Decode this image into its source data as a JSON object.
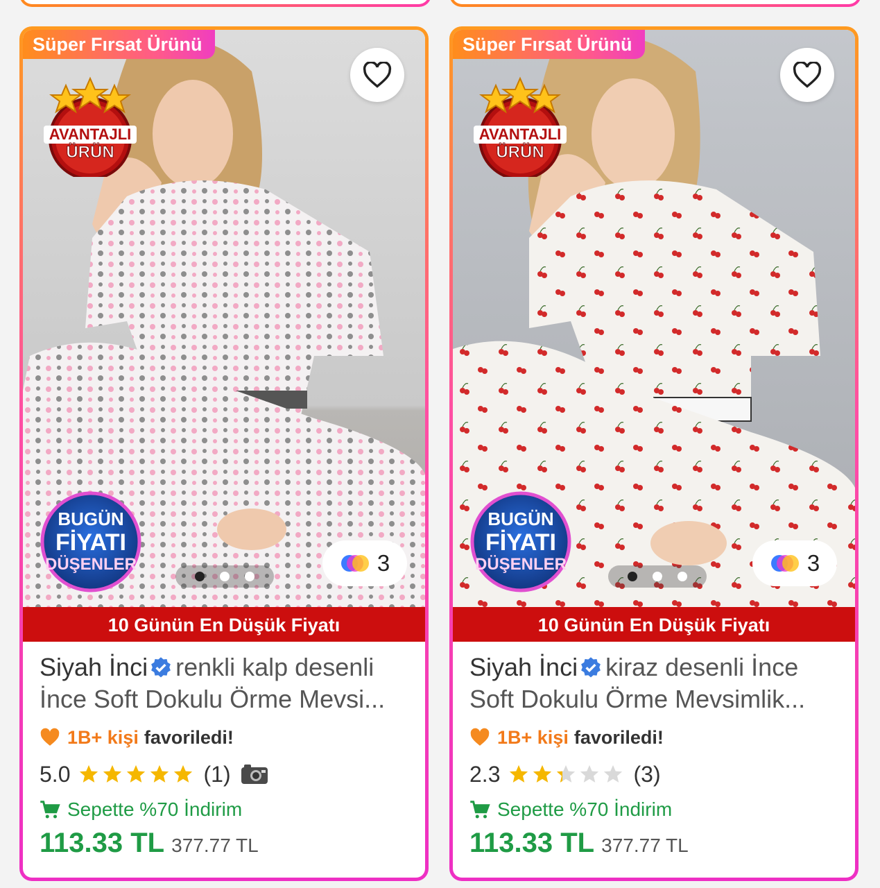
{
  "products": [
    {
      "super_badge": "Süper Fırsat Ürünü",
      "advantage_badge": [
        "AVANTAJLI",
        "ÜRÜN"
      ],
      "price_drop_badge": [
        "BUGÜN",
        "FİYATI",
        "DÜŞENLER"
      ],
      "variant_count": "3",
      "lowest_price_bar": "10 Günün En Düşük Fiyatı",
      "brand": "Siyah İnci",
      "title_line1": "renkli kalp desenli",
      "title_line2": "İnce Soft Dokulu Örme Mevsi...",
      "fav_count": "1B+ kişi",
      "fav_text": "favoriledi!",
      "rating": "5.0",
      "rating_stars": 5.0,
      "review_count": "(1)",
      "has_photo_reviews": true,
      "basket_discount": "Sepette %70 İndirim",
      "price": "113.33 TL",
      "old_price": "377.77 TL",
      "pattern": "hearts"
    },
    {
      "super_badge": "Süper Fırsat Ürünü",
      "advantage_badge": [
        "AVANTAJLI",
        "ÜRÜN"
      ],
      "price_drop_badge": [
        "BUGÜN",
        "FİYATI",
        "DÜŞENLER"
      ],
      "variant_count": "3",
      "lowest_price_bar": "10 Günün En Düşük Fiyatı",
      "brand": "Siyah İnci",
      "title_line1": "kiraz desenli İnce",
      "title_line2": "Soft Dokulu Örme Mevsimlik...",
      "fav_count": "1B+ kişi",
      "fav_text": "favoriledi!",
      "rating": "2.3",
      "rating_stars": 2.3,
      "review_count": "(3)",
      "has_photo_reviews": false,
      "basket_discount": "Sepette %70 İndirim",
      "price": "113.33 TL",
      "old_price": "377.77 TL",
      "pattern": "cherries"
    }
  ],
  "colors": {
    "star_filled": "#f5b700",
    "star_empty": "#d9d9d9",
    "discount_green": "#1f9b45",
    "orange_accent": "#f27a1a",
    "lowest_bar_red": "#cc0e0e"
  },
  "icons": [
    "heart-icon",
    "verified-icon",
    "orange-heart-icon",
    "star-icon",
    "camera-icon",
    "basket-icon",
    "color-swatch-icon"
  ]
}
